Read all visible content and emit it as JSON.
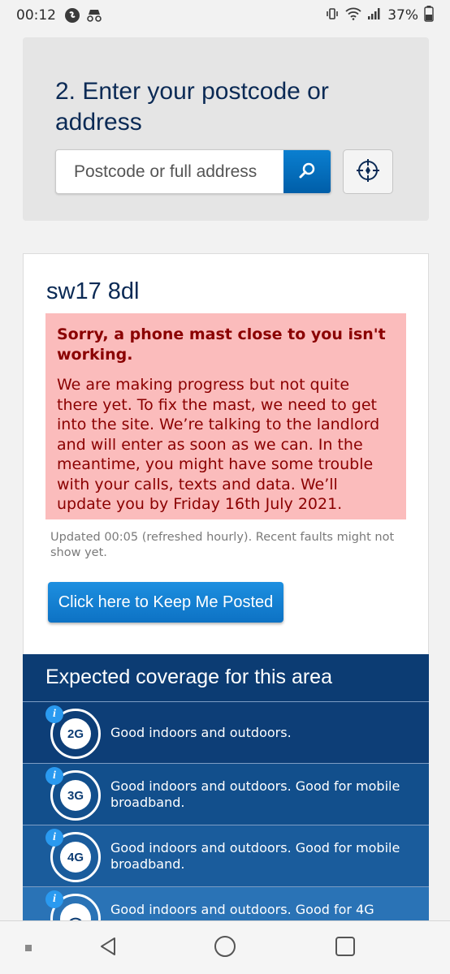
{
  "status_bar": {
    "time": "00:12",
    "battery": "37%"
  },
  "step": {
    "title": "2. Enter your postcode or address",
    "search_placeholder": "Postcode or full address"
  },
  "result": {
    "postcode": "sw17 8dl",
    "alert_title": "Sorry, a phone mast close to you isn't working.",
    "alert_body": "We are making progress but not quite there yet. To fix the mast, we need to get into the site. We’re talking to the landlord and will enter as soon as we can. In the meantime, you might have some trouble with your calls, texts and data. We’ll update you by Friday 16th July 2021.",
    "updated": "Updated 00:05 (refreshed hourly). Recent faults might not show yet.",
    "keep_posted": "Click here to Keep Me Posted"
  },
  "coverage": {
    "title": "Expected coverage for this area",
    "rows": [
      {
        "network": "2G",
        "text": "Good indoors and outdoors."
      },
      {
        "network": "3G",
        "text": "Good indoors and outdoors. Good for mobile broadband."
      },
      {
        "network": "4G",
        "text": "Good indoors and outdoors. Good for mobile broadband."
      },
      {
        "network": "",
        "text": "Good indoors and outdoors. Good for 4G"
      }
    ]
  },
  "colors": {
    "brand_navy": "#0b2a55",
    "button_blue": "#0d72c4",
    "alert_bg": "#fbbcbc",
    "alert_text": "#8a0000"
  }
}
